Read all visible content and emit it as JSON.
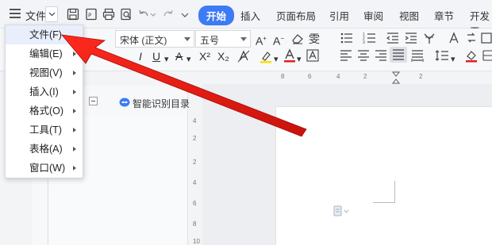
{
  "titlebar": {
    "file_label": "文件",
    "tabs": [
      "开始",
      "插入",
      "页面布局",
      "引用",
      "审阅",
      "视图",
      "章节",
      "开发工"
    ],
    "active_tab": "开始"
  },
  "ribbon": {
    "font_name": "宋体 (正文)",
    "font_size": "五号",
    "clear_format_glyph": "A",
    "superscript": "X²",
    "subscript": "X₂",
    "pinyin_glyph": "雯"
  },
  "ruler": {
    "h_ticks": [
      "8",
      "6",
      "4",
      "2",
      "2"
    ],
    "v_ticks": [
      "4",
      "2",
      "2",
      "4",
      "6",
      "8",
      "10"
    ]
  },
  "navpane": {
    "smart_toc_label": "智能识别目录"
  },
  "menu": {
    "items": [
      {
        "label": "文件(F)",
        "has_submenu": false
      },
      {
        "label": "编辑(E)",
        "has_submenu": true
      },
      {
        "label": "视图(V)",
        "has_submenu": true
      },
      {
        "label": "插入(I)",
        "has_submenu": true
      },
      {
        "label": "格式(O)",
        "has_submenu": true
      },
      {
        "label": "工具(T)",
        "has_submenu": true
      },
      {
        "label": "表格(A)",
        "has_submenu": true
      },
      {
        "label": "窗口(W)",
        "has_submenu": true
      }
    ]
  },
  "colors": {
    "accent": "#3d7bf6",
    "annotation_arrow": "#e8211c"
  }
}
